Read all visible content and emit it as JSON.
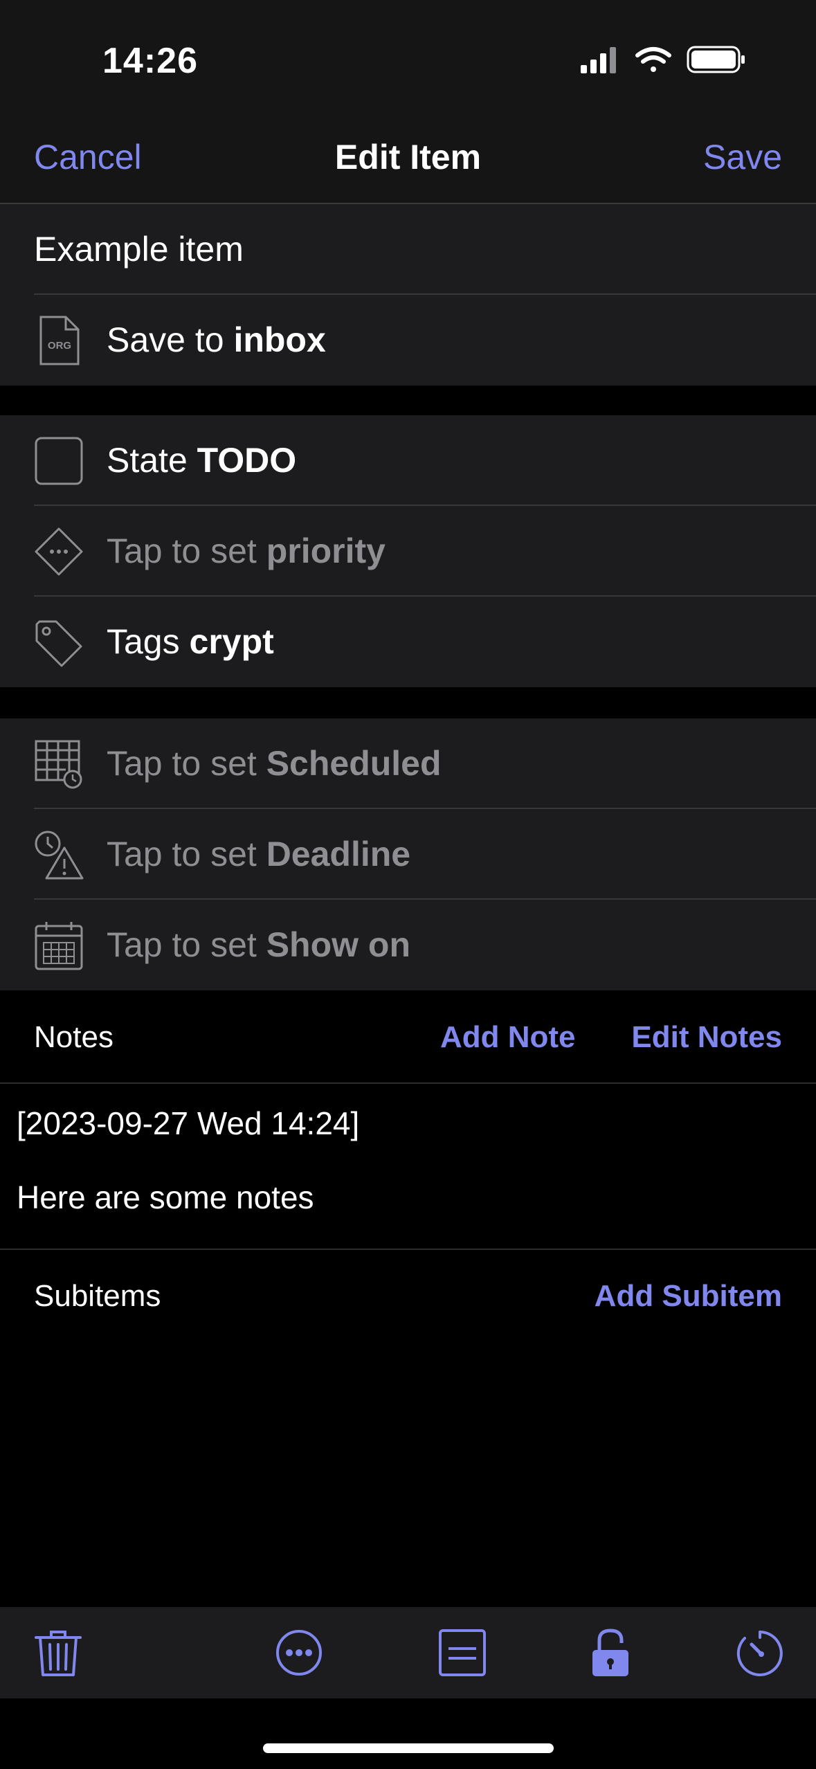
{
  "status": {
    "time": "14:26"
  },
  "nav": {
    "cancel": "Cancel",
    "title": "Edit Item",
    "save": "Save"
  },
  "item": {
    "title": "Example item",
    "save_prefix": "Save to ",
    "save_target": "inbox",
    "org_label": "ORG"
  },
  "props": {
    "state_prefix": "State ",
    "state_value": "TODO",
    "priority_prefix": "Tap to set ",
    "priority_value": "priority",
    "tags_prefix": "Tags ",
    "tags_value": "crypt"
  },
  "dates": {
    "scheduled_prefix": "Tap to set ",
    "scheduled_value": "Scheduled",
    "deadline_prefix": "Tap to set ",
    "deadline_value": "Deadline",
    "showon_prefix": "Tap to set ",
    "showon_value": "Show on"
  },
  "notes": {
    "label": "Notes",
    "add_note": "Add Note",
    "edit_notes": "Edit Notes",
    "timestamp": "[2023-09-27 Wed 14:24]",
    "body": "Here are some notes"
  },
  "subitems": {
    "label": "Subitems",
    "add_subitem": "Add Subitem"
  },
  "toolbar": {
    "icons": [
      "trash-icon",
      "more-icon",
      "notes-icon",
      "unlock-icon",
      "timer-icon"
    ]
  },
  "colors": {
    "accent": "#8088ee",
    "background": "#000000",
    "cell": "#1c1c1e",
    "dim": "#8e8e93"
  }
}
